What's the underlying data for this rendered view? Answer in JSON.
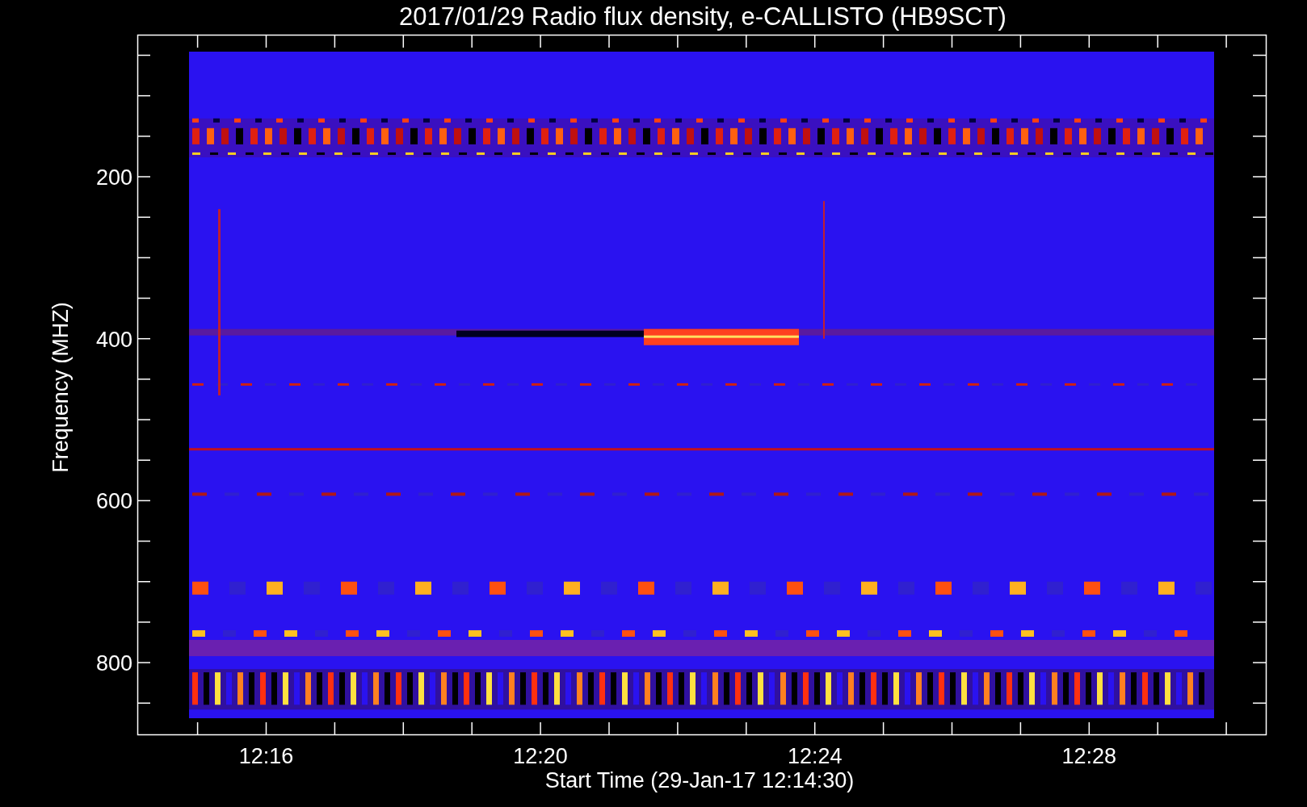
{
  "plot": {
    "title": "2017/01/29  Radio flux density, e-CALLISTO (HB9SCT)",
    "ylabel": "Frequency (MHZ)",
    "xlabel": "Start Time (29-Jan-17 12:14:30)",
    "yticks": [
      "200",
      "400",
      "600",
      "800"
    ],
    "xticks": [
      "12:16",
      "12:20",
      "12:24",
      "12:28"
    ]
  }
}
